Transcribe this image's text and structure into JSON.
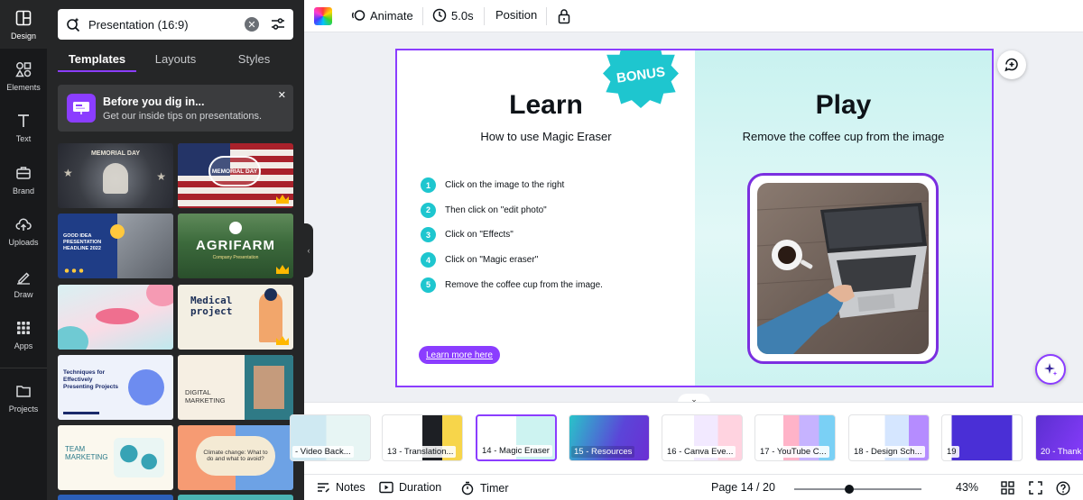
{
  "rail": {
    "items": [
      {
        "label": "Design",
        "icon": "layout-icon"
      },
      {
        "label": "Elements",
        "icon": "shapes-icon"
      },
      {
        "label": "Text",
        "icon": "text-icon"
      },
      {
        "label": "Brand",
        "icon": "briefcase-icon"
      },
      {
        "label": "Uploads",
        "icon": "cloud-upload-icon"
      },
      {
        "label": "Draw",
        "icon": "pen-icon"
      },
      {
        "label": "Apps",
        "icon": "grid-icon"
      },
      {
        "label": "Projects",
        "icon": "folder-icon"
      }
    ]
  },
  "panel": {
    "search_value": "Presentation (16:9)",
    "tabs": [
      "Templates",
      "Layouts",
      "Styles"
    ],
    "tip": {
      "title": "Before you dig in...",
      "subtitle": "Get our inside tips on presentations."
    },
    "templates": {
      "memorial": "MEMORIAL DAY",
      "flag": "MEMORIAL DAY",
      "goodidea": "GOOD IDEA PRESENTATION HEADLINE 2022",
      "agrifarm": "AGRIFARM",
      "agrifarm_sub": "Company Presentation",
      "medical": "Medical project",
      "techniques": "Techniques for Effectively Presenting Projects",
      "digital": "DIGITAL MARKETING",
      "team": "TEAM MARKETING",
      "climate": "Climate change: What to do and what to avoid?"
    }
  },
  "toolbar": {
    "animate": "Animate",
    "duration": "5.0s",
    "position": "Position"
  },
  "slide": {
    "bonus": "BONUS",
    "learn_title": "Learn",
    "learn_subtitle": "How to use Magic Eraser",
    "play_title": "Play",
    "play_subtitle": "Remove the coffee cup from the image",
    "steps": [
      {
        "num": "1",
        "text": "Click on the image to the right"
      },
      {
        "num": "2",
        "text": "Then click on \"edit photo\""
      },
      {
        "num": "3",
        "text": "Click on \"Effects\""
      },
      {
        "num": "4",
        "text": "Click on \"Magic eraser\""
      },
      {
        "num": "5",
        "text": "Remove the coffee cup from the image."
      }
    ],
    "button": "Learn more here"
  },
  "pages": [
    {
      "label": "- Video Back..."
    },
    {
      "label": "13 - Translation..."
    },
    {
      "label": "14 - Magic Eraser",
      "active": true
    },
    {
      "label": "15 - Resources"
    },
    {
      "label": "16 - Canva Eve..."
    },
    {
      "label": "17 - YouTube C..."
    },
    {
      "label": "18 - Design Sch..."
    },
    {
      "label": "19"
    },
    {
      "label": "20 - Thank"
    }
  ],
  "bottom": {
    "notes": "Notes",
    "duration": "Duration",
    "timer": "Timer",
    "page": "Page 14 / 20",
    "zoom": "43%",
    "zoom_fraction": 0.43
  },
  "colors": {
    "accent": "#8b3dff",
    "teal": "#1ec6cf",
    "rail_bg": "#18191b",
    "panel_bg": "#252627"
  }
}
